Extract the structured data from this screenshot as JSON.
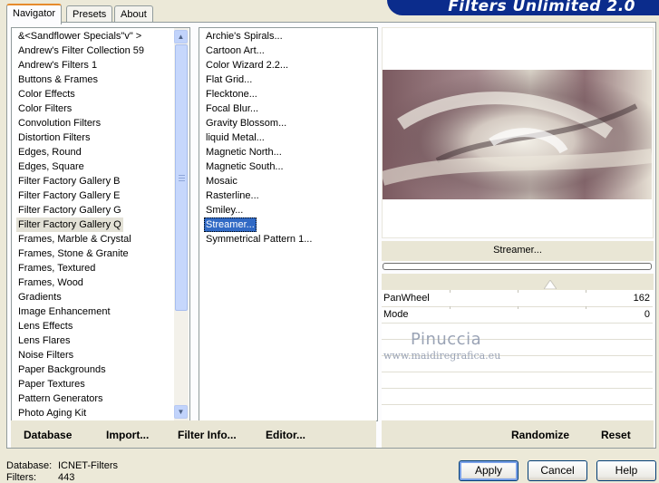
{
  "banner": {
    "title": "Filters Unlimited 2.0"
  },
  "tabs": [
    {
      "label": "Navigator",
      "active": true
    },
    {
      "label": "Presets",
      "active": false
    },
    {
      "label": "About",
      "active": false
    }
  ],
  "categories": [
    "&<Sandflower Specials\"v\" >",
    "Andrew's Filter Collection 59",
    "Andrew's Filters 1",
    "Buttons & Frames",
    "Color Effects",
    "Color Filters",
    "Convolution Filters",
    "Distortion Filters",
    "Edges, Round",
    "Edges, Square",
    "Filter Factory Gallery B",
    "Filter Factory Gallery E",
    "Filter Factory Gallery G",
    "Filter Factory Gallery Q",
    "Frames, Marble & Crystal",
    "Frames, Stone & Granite",
    "Frames, Textured",
    "Frames, Wood",
    "Gradients",
    "Image Enhancement",
    "Lens Effects",
    "Lens Flares",
    "Noise Filters",
    "Paper Backgrounds",
    "Paper Textures",
    "Pattern Generators",
    "Photo Aging Kit"
  ],
  "selected_category": "Filter Factory Gallery Q",
  "filters": [
    "Archie's Spirals...",
    "Cartoon Art...",
    "Color Wizard 2.2...",
    "Flat Grid...",
    "Flecktone...",
    "Focal Blur...",
    "Gravity Blossom...",
    "liquid Metal...",
    "Magnetic North...",
    "Magnetic South...",
    "Mosaic",
    "Rasterline...",
    "Smiley...",
    "Streamer...",
    "Symmetrical Pattern 1..."
  ],
  "selected_filter": "Streamer...",
  "filter_name": "Streamer...",
  "params": [
    {
      "label": "PanWheel",
      "value": "162",
      "slider_fraction": 0.62
    },
    {
      "label": "Mode",
      "value": "0"
    }
  ],
  "watermark": {
    "name": "Pinuccia",
    "url": "www.maidiregrafica.eu"
  },
  "toolbar": {
    "database": "Database",
    "import": "Import...",
    "filter_info": "Filter Info...",
    "editor": "Editor...",
    "randomize": "Randomize",
    "reset": "Reset"
  },
  "status": {
    "database_label": "Database:",
    "database_value": "ICNET-Filters",
    "filters_label": "Filters:",
    "filters_value": "443"
  },
  "dialog": {
    "apply": "Apply",
    "cancel": "Cancel",
    "help": "Help"
  }
}
